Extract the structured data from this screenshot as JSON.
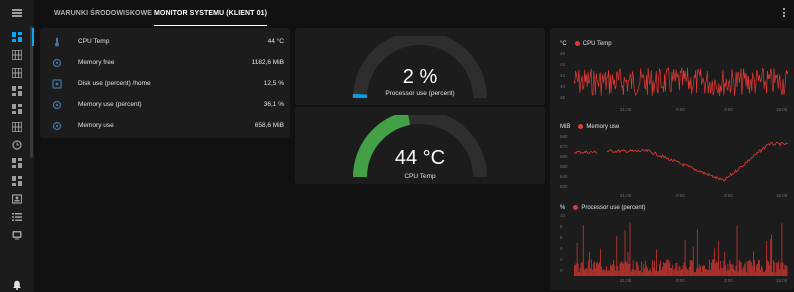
{
  "tabs": [
    {
      "label": "WARUNKI ŚRODOWISKOWE",
      "active": false
    },
    {
      "label": "MONITOR SYSTEMU (KLIENT 01)",
      "active": true
    }
  ],
  "sidebar": {
    "items": [
      {
        "icon": "dashboard-icon",
        "active": true
      },
      {
        "icon": "grid-icon"
      },
      {
        "icon": "grid-icon"
      },
      {
        "icon": "dashboard-icon"
      },
      {
        "icon": "dashboard-icon"
      },
      {
        "icon": "grid-icon"
      },
      {
        "icon": "clock-icon"
      },
      {
        "icon": "dashboard-icon"
      },
      {
        "icon": "dashboard-icon"
      },
      {
        "icon": "badge-icon"
      },
      {
        "icon": "list-icon"
      },
      {
        "icon": "tv-icon"
      },
      {
        "icon": "bell-icon"
      }
    ]
  },
  "entities": [
    {
      "icon": "thermometer-icon",
      "name": "CPU Temp",
      "value": "44 °C"
    },
    {
      "icon": "memory-icon",
      "name": "Memory free",
      "value": "1182,6 MiB"
    },
    {
      "icon": "harddisk-icon",
      "name": "Disk use (percent) /home",
      "value": "12,5 %"
    },
    {
      "icon": "memory-icon",
      "name": "Memory use (percent)",
      "value": "36,1 %"
    },
    {
      "icon": "memory-icon",
      "name": "Memory use",
      "value": "658,6 MiB"
    }
  ],
  "gauges": [
    {
      "value_text": "2 %",
      "label": "Processor use (percent)",
      "fraction": 0.02,
      "color": "#039be5"
    },
    {
      "value_text": "44 °C",
      "label": "CPU Temp",
      "fraction": 0.44,
      "color": "#43a047"
    }
  ],
  "graphs": [
    {
      "unit": "°C",
      "name": "CPU Temp",
      "y_ticks": [
        "46",
        "44",
        "42",
        "40",
        "38"
      ],
      "x_ticks": [
        "21:00",
        "0:00",
        "3:00",
        "15:00"
      ]
    },
    {
      "unit": "MiB",
      "name": "Memory use",
      "y_ticks": [
        "680",
        "670",
        "660",
        "650",
        "640",
        "630"
      ],
      "x_ticks": [
        "21:00",
        "0:00",
        "3:00",
        "15:00"
      ]
    },
    {
      "unit": "%",
      "name": "Processor use (percent)",
      "y_ticks": [
        "10",
        "8",
        "6",
        "4",
        "2",
        "0"
      ],
      "x_ticks": [
        "21:00",
        "0:00",
        "3:00",
        "15:00"
      ]
    }
  ],
  "colors": {
    "accent": "#03a9f4",
    "series": "#e53935",
    "card": "#1c1c1c",
    "background": "#111111"
  }
}
